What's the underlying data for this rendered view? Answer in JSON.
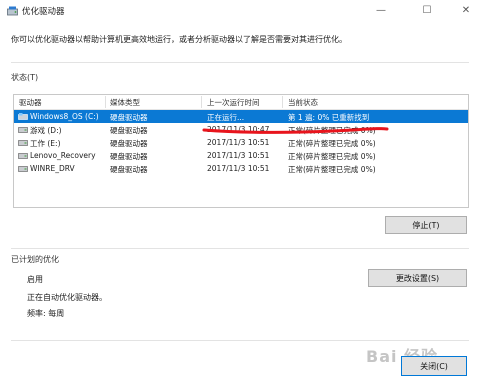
{
  "window": {
    "title": "优化驱动器",
    "minimize_glyph": "—",
    "maximize_glyph": "☐",
    "close_glyph": "✕"
  },
  "description": "你可以优化驱动器以帮助计算机更高效地运行，或者分析驱动器以了解是否需要对其进行优化。",
  "status_section": {
    "label": "状态(T)"
  },
  "table": {
    "columns": [
      "驱动器",
      "媒体类型",
      "上一次运行时间",
      "当前状态"
    ],
    "rows": [
      {
        "drive": "Windows8_OS (C:)",
        "media": "硬盘驱动器",
        "last_run": "正在运行...",
        "status": "第 1 遍: 0% 已重新找到",
        "selected": true
      },
      {
        "drive": "游戏 (D:)",
        "media": "硬盘驱动器",
        "last_run": "2017/11/3 10:47",
        "status": "正常(碎片整理已完成 0%)",
        "selected": false
      },
      {
        "drive": "工作 (E:)",
        "media": "硬盘驱动器",
        "last_run": "2017/11/3 10:51",
        "status": "正常(碎片整理已完成 0%)",
        "selected": false
      },
      {
        "drive": "Lenovo_Recovery",
        "media": "硬盘驱动器",
        "last_run": "2017/11/3 10:51",
        "status": "正常(碎片整理已完成 0%)",
        "selected": false
      },
      {
        "drive": "WINRE_DRV",
        "media": "硬盘驱动器",
        "last_run": "2017/11/3 10:51",
        "status": "正常(碎片整理已完成 0%)",
        "selected": false
      }
    ]
  },
  "stop_button": "停止(T)",
  "scheduled": {
    "label": "已计划的优化",
    "enabled": "启用",
    "info": "正在自动优化驱动器。",
    "frequency": "频率: 每周",
    "change_button": "更改设置(S)"
  },
  "close_button": "关闭(C)",
  "watermark": "Bai 经验",
  "colors": {
    "selection": "#0b79d4",
    "annotation": "#e8141c"
  }
}
